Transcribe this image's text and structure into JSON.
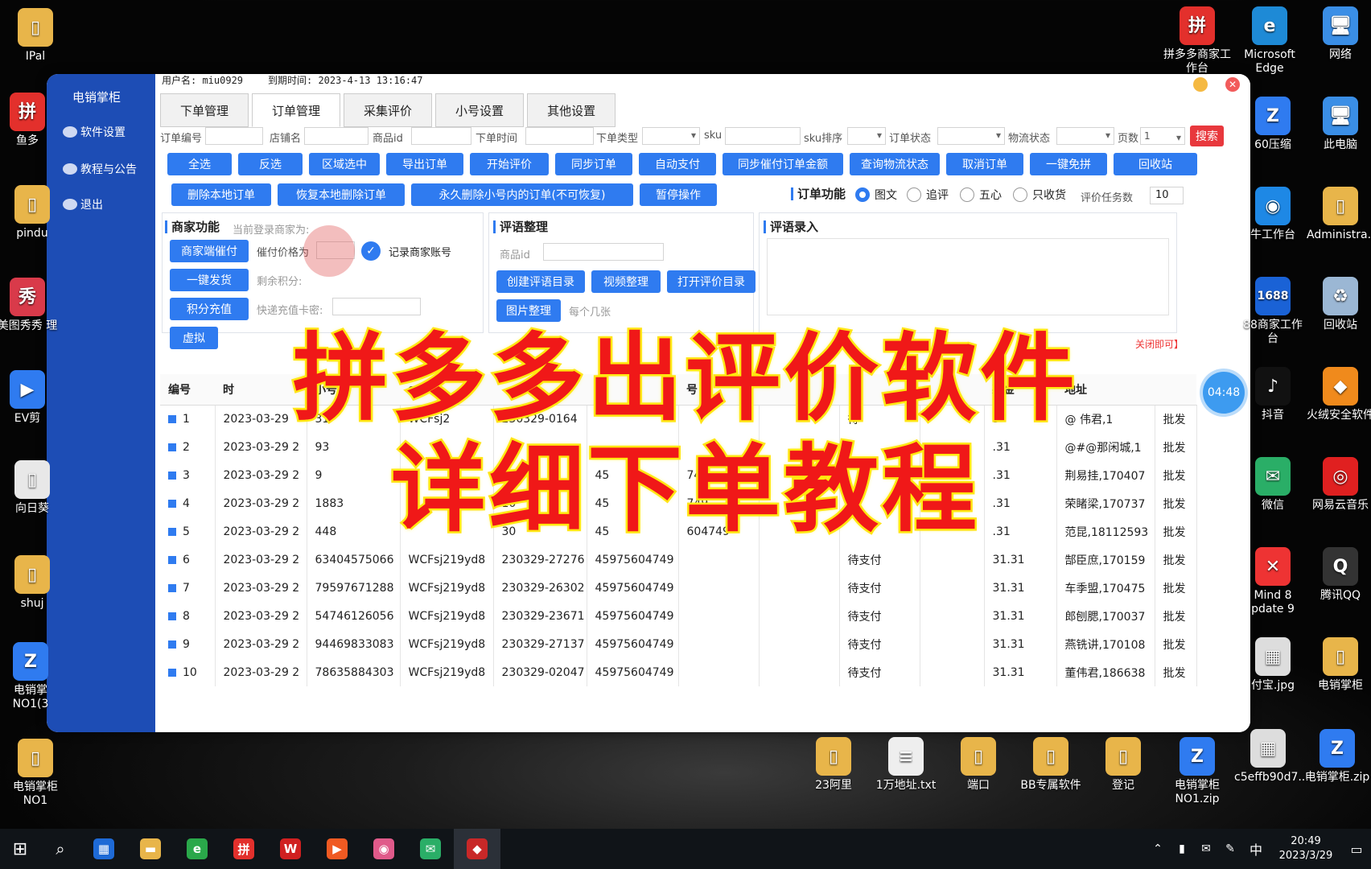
{
  "desktop_left": [
    {
      "label": "IPal",
      "color": "#e8b54a",
      "glyph": "▯"
    },
    {
      "label": "鱼多",
      "color": "#e3302c",
      "glyph": "拼"
    },
    {
      "label": "pindu",
      "color": "#e8b54a",
      "glyph": "▯"
    },
    {
      "label": "美图秀秀 理",
      "color": "#d93a4a",
      "glyph": "秀"
    },
    {
      "label": "EV剪",
      "color": "#2f7bf0",
      "glyph": "▶"
    },
    {
      "label": "向日葵",
      "color": "#e8e8e8",
      "glyph": "▯"
    },
    {
      "label": "shuj",
      "color": "#e8b54a",
      "glyph": "▯"
    },
    {
      "label": "电销掌 NO1(3",
      "color": "#2f7bf0",
      "glyph": "Z"
    },
    {
      "label": "电销掌柜NO1",
      "color": "#e8b54a",
      "glyph": "▯"
    }
  ],
  "desktop_right": [
    {
      "label": "拼多多商家工作台",
      "color": "#e3302c",
      "glyph": "拼"
    },
    {
      "label": "Microsoft Edge",
      "color": "#1e8ad6",
      "glyph": "e"
    },
    {
      "label": "网络",
      "color": "#3a8ee6",
      "glyph": "🖥"
    },
    {
      "label": "60压缩",
      "color": "#2f7bf0",
      "glyph": "Z"
    },
    {
      "label": "此电脑",
      "color": "#3a8ee6",
      "glyph": "🖥"
    },
    {
      "label": "牛工作台",
      "color": "#1e88e5",
      "glyph": "◉"
    },
    {
      "label": "Administra...",
      "color": "#e8b54a",
      "glyph": "▯"
    },
    {
      "label": "88商家工作台",
      "color": "#1a62d6",
      "glyph": "1688"
    },
    {
      "label": "回收站",
      "color": "#9bb7d4",
      "glyph": "♻"
    },
    {
      "label": "抖音",
      "color": "#111",
      "glyph": "♪"
    },
    {
      "label": "火绒安全软件",
      "color": "#f08a1c",
      "glyph": "◆"
    },
    {
      "label": "微信",
      "color": "#2aae67",
      "glyph": "✉"
    },
    {
      "label": "网易云音乐",
      "color": "#e02020",
      "glyph": "◎"
    },
    {
      "label": "Mind 8 pdate 9",
      "color": "#e33",
      "glyph": "✕"
    },
    {
      "label": "腾讯QQ",
      "color": "#333",
      "glyph": "Q"
    },
    {
      "label": "付宝.jpg",
      "color": "#ddd",
      "glyph": "▦"
    },
    {
      "label": "电销掌柜",
      "color": "#e8b54a",
      "glyph": "▯"
    },
    {
      "label": "c5effb90d7...",
      "color": "#ddd",
      "glyph": "▦"
    },
    {
      "label": "电销掌柜.zip",
      "color": "#2f7bf0",
      "glyph": "Z"
    }
  ],
  "desktop_bottom": [
    {
      "label": "23阿里",
      "color": "#e8b54a",
      "glyph": "▯"
    },
    {
      "label": "1万地址.txt",
      "color": "#eee",
      "glyph": "≡"
    },
    {
      "label": "端口",
      "color": "#e8b54a",
      "glyph": "▯"
    },
    {
      "label": "BB专属软件",
      "color": "#e8b54a",
      "glyph": "▯"
    },
    {
      "label": "登记",
      "color": "#e8b54a",
      "glyph": "▯"
    },
    {
      "label": "电销掌柜 NO1.zip",
      "color": "#2f7bf0",
      "glyph": "Z"
    }
  ],
  "taskbar": {
    "clock_time": "20:49",
    "clock_date": "2023/3/29",
    "ime": "中",
    "apps": [
      {
        "name": "calculator",
        "color": "#1e6ad6",
        "glyph": "▦"
      },
      {
        "name": "file-explorer",
        "color": "#e8b54a",
        "glyph": "▬"
      },
      {
        "name": "browser",
        "color": "#2aa84a",
        "glyph": "e"
      },
      {
        "name": "pdd",
        "color": "#e3302c",
        "glyph": "拼"
      },
      {
        "name": "wps",
        "color": "#d02020",
        "glyph": "W"
      },
      {
        "name": "media",
        "color": "#f05a22",
        "glyph": "▶"
      },
      {
        "name": "meitu",
        "color": "#e05a8a",
        "glyph": "◉"
      },
      {
        "name": "wechat",
        "color": "#2aae67",
        "glyph": "✉"
      },
      {
        "name": "dianxiao",
        "color": "#c82828",
        "glyph": "◆"
      }
    ]
  },
  "app": {
    "title": "电销掌柜",
    "user": "用户名: miu0929",
    "expiry": "到期时间: 2023-4-13 13:16:47",
    "sidebar": [
      "软件设置",
      "教程与公告",
      "退出"
    ],
    "tabs": [
      "下单管理",
      "订单管理",
      "采集评价",
      "小号设置",
      "其他设置"
    ],
    "filters": {
      "order_no": "订单编号",
      "shop": "店铺名",
      "goods_id": "商品id",
      "order_time": "下单时间",
      "order_type": "下单类型",
      "sku": "sku",
      "sku_sort": "sku排序",
      "order_status": "订单状态",
      "logistics": "物流状态",
      "pages": "页数",
      "pages_value": "1",
      "search": "搜索"
    },
    "row1": [
      "全选",
      "反选",
      "区域选中",
      "导出订单",
      "开始评价",
      "同步订单",
      "自动支付",
      "同步催付订单金额",
      "查询物流状态",
      "取消订单",
      "一键免拼",
      "回收站"
    ],
    "row2": [
      "删除本地订单",
      "恢复本地删除订单",
      "永久删除小号内的订单(不可恢复)",
      "暂停操作"
    ],
    "order_func": {
      "title": "订单功能",
      "options": [
        "图文",
        "追评",
        "五心",
        "只收货"
      ],
      "task_label": "评价任务数",
      "task_value": "10"
    },
    "merchant": {
      "title": "商家功能",
      "current": "当前登录商家为:",
      "buttons": [
        "商家端催付",
        "一键发货",
        "积分充值",
        "虚拟"
      ],
      "price_label": "催付价格为",
      "remember": "记录商家账号",
      "points": "剩余积分:",
      "express": "快递充值卡密:"
    },
    "review": {
      "title": "评语整理",
      "goods_id": "商品id",
      "buttons": [
        "创建评语目录",
        "视频整理",
        "打开评价目录",
        "图片整理"
      ],
      "per_pic": "每个几张"
    },
    "entry": {
      "title": "评语录入"
    },
    "table": {
      "headers": [
        "编号",
        "时",
        "小号",
        "en",
        "",
        "id",
        "号",
        "",
        "",
        "",
        "款金",
        "地址",
        ""
      ],
      "rows": [
        [
          "1",
          "2023-03-29",
          "31",
          "WCFsj2",
          "230329-0164",
          "",
          "",
          "",
          "待",
          "",
          "3",
          "@ 伟君,1",
          "批发"
        ],
        [
          "2",
          "2023-03-29 2",
          "93",
          "",
          "",
          "",
          "",
          "",
          "",
          "",
          ".31",
          "@#@那闲城,1",
          "批发"
        ],
        [
          "3",
          "2023-03-29 2",
          "9",
          "",
          "86",
          "45",
          "749",
          "",
          "",
          "",
          ".31",
          "荆易挂,170407",
          "批发"
        ],
        [
          "4",
          "2023-03-29 2",
          "1883",
          "",
          "10",
          "45",
          "749",
          "",
          "",
          "",
          ".31",
          "荣睹梁,170737",
          "批发"
        ],
        [
          "5",
          "2023-03-29 2",
          "448",
          "",
          "30",
          "45",
          "604749",
          "",
          "",
          "",
          ".31",
          "范昆,18112593",
          "批发"
        ],
        [
          "6",
          "2023-03-29 2",
          "63404575066",
          "WCFsj219yd8",
          "230329-27276",
          "45975604749",
          "",
          "",
          "待支付",
          "",
          "31.31",
          "郜臣庶,170159",
          "批发"
        ],
        [
          "7",
          "2023-03-29 2",
          "79597671288",
          "WCFsj219yd8",
          "230329-26302",
          "45975604749",
          "",
          "",
          "待支付",
          "",
          "31.31",
          "车季盟,170475",
          "批发"
        ],
        [
          "8",
          "2023-03-29 2",
          "54746126056",
          "WCFsj219yd8",
          "230329-23671",
          "45975604749",
          "",
          "",
          "待支付",
          "",
          "31.31",
          "郎刨腮,170037",
          "批发"
        ],
        [
          "9",
          "2023-03-29 2",
          "94469833083",
          "WCFsj219yd8",
          "230329-27137",
          "45975604749",
          "",
          "",
          "待支付",
          "",
          "31.31",
          "燕铣讲,170108",
          "批发"
        ],
        [
          "10",
          "2023-03-29 2",
          "78635884303",
          "WCFsj219yd8",
          "230329-02047",
          "45975604749",
          "",
          "",
          "待支付",
          "",
          "31.31",
          "董伟君,186638",
          "批发"
        ]
      ]
    },
    "partial_text": {
      "p1": "码",
      "p2": "关闭即可】"
    },
    "timer": "04:48"
  },
  "overlay": {
    "line1": "拼多多出评价软件",
    "line2": "详细下单教程"
  },
  "colors": {
    "accent": "#2f7bf0",
    "sidebar": "#1d4db5",
    "overlay_text": "#f01818",
    "overlay_stroke": "#ffe21a"
  }
}
